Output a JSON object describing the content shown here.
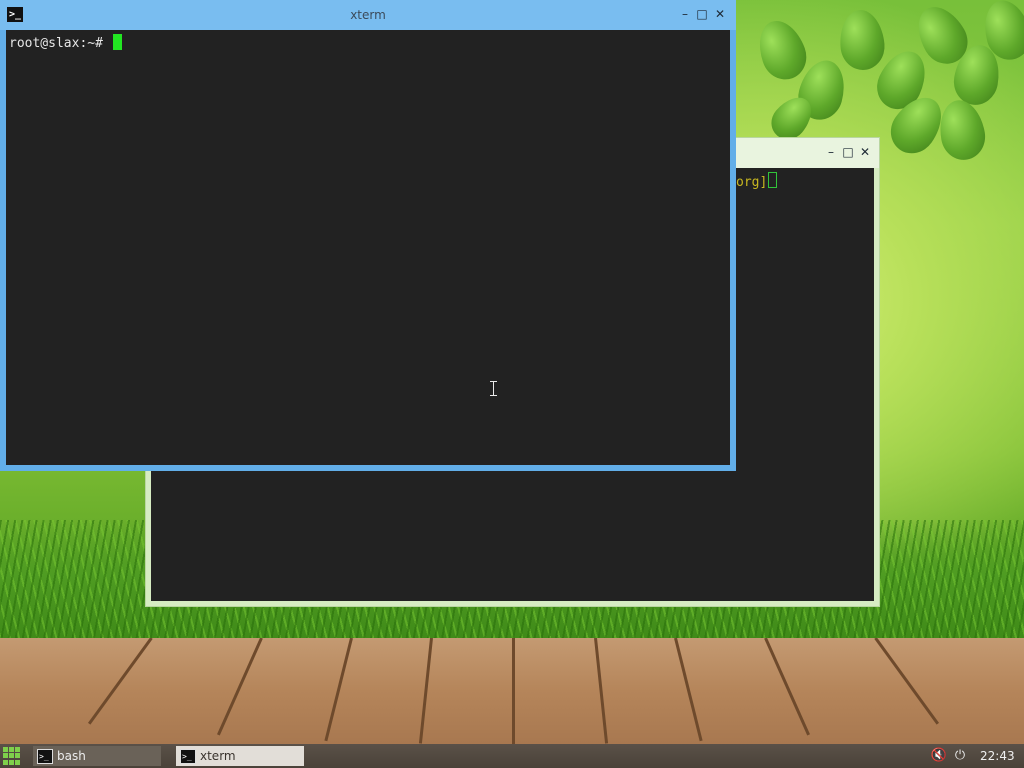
{
  "desktop": {
    "taskbar": {
      "tasks": [
        {
          "label": "bash",
          "icon": "terminal-icon"
        },
        {
          "label": "xterm",
          "icon": "terminal-icon"
        }
      ],
      "clock": "22:43",
      "tray_icons": [
        "volume-muted-icon",
        "power-icon"
      ]
    }
  },
  "front_window": {
    "title": "xterm",
    "prompt": "root@slax:~# ",
    "controls": [
      "minimize",
      "maximize",
      "close"
    ],
    "colors": {
      "titlebar": "#79bdf0",
      "border": "#62aee8",
      "terminal_bg": "#222222",
      "cursor": "#22e622"
    }
  },
  "back_window": {
    "visible_text": "org]",
    "colors": {
      "frame": "#d6ecc2",
      "text": "#c8b820"
    }
  },
  "glyphs": {
    "minimize": "–",
    "maximize": "□",
    "close": "✕",
    "app_icon": ">_",
    "volume": "🔇",
    "power": "⏻"
  }
}
